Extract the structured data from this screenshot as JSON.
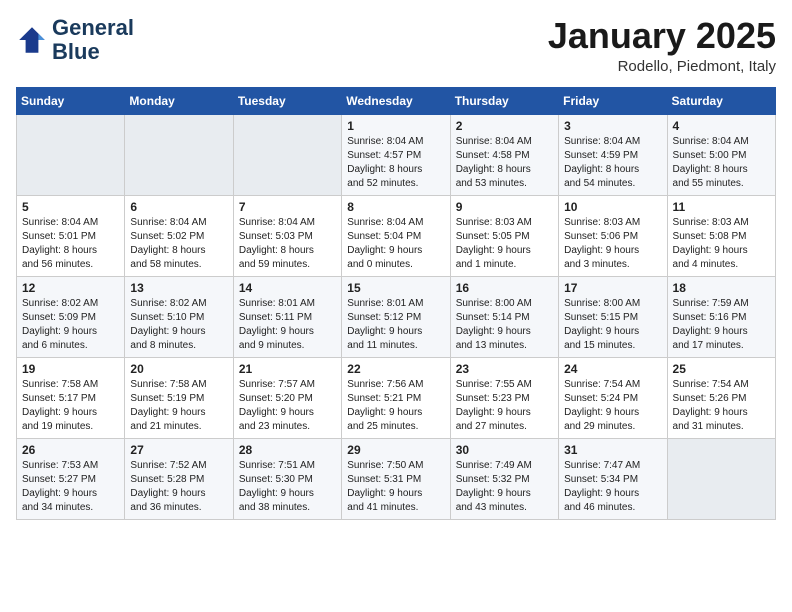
{
  "logo": {
    "line1": "General",
    "line2": "Blue"
  },
  "title": "January 2025",
  "subtitle": "Rodello, Piedmont, Italy",
  "weekdays": [
    "Sunday",
    "Monday",
    "Tuesday",
    "Wednesday",
    "Thursday",
    "Friday",
    "Saturday"
  ],
  "weeks": [
    [
      {
        "day": "",
        "info": ""
      },
      {
        "day": "",
        "info": ""
      },
      {
        "day": "",
        "info": ""
      },
      {
        "day": "1",
        "info": "Sunrise: 8:04 AM\nSunset: 4:57 PM\nDaylight: 8 hours\nand 52 minutes."
      },
      {
        "day": "2",
        "info": "Sunrise: 8:04 AM\nSunset: 4:58 PM\nDaylight: 8 hours\nand 53 minutes."
      },
      {
        "day": "3",
        "info": "Sunrise: 8:04 AM\nSunset: 4:59 PM\nDaylight: 8 hours\nand 54 minutes."
      },
      {
        "day": "4",
        "info": "Sunrise: 8:04 AM\nSunset: 5:00 PM\nDaylight: 8 hours\nand 55 minutes."
      }
    ],
    [
      {
        "day": "5",
        "info": "Sunrise: 8:04 AM\nSunset: 5:01 PM\nDaylight: 8 hours\nand 56 minutes."
      },
      {
        "day": "6",
        "info": "Sunrise: 8:04 AM\nSunset: 5:02 PM\nDaylight: 8 hours\nand 58 minutes."
      },
      {
        "day": "7",
        "info": "Sunrise: 8:04 AM\nSunset: 5:03 PM\nDaylight: 8 hours\nand 59 minutes."
      },
      {
        "day": "8",
        "info": "Sunrise: 8:04 AM\nSunset: 5:04 PM\nDaylight: 9 hours\nand 0 minutes."
      },
      {
        "day": "9",
        "info": "Sunrise: 8:03 AM\nSunset: 5:05 PM\nDaylight: 9 hours\nand 1 minute."
      },
      {
        "day": "10",
        "info": "Sunrise: 8:03 AM\nSunset: 5:06 PM\nDaylight: 9 hours\nand 3 minutes."
      },
      {
        "day": "11",
        "info": "Sunrise: 8:03 AM\nSunset: 5:08 PM\nDaylight: 9 hours\nand 4 minutes."
      }
    ],
    [
      {
        "day": "12",
        "info": "Sunrise: 8:02 AM\nSunset: 5:09 PM\nDaylight: 9 hours\nand 6 minutes."
      },
      {
        "day": "13",
        "info": "Sunrise: 8:02 AM\nSunset: 5:10 PM\nDaylight: 9 hours\nand 8 minutes."
      },
      {
        "day": "14",
        "info": "Sunrise: 8:01 AM\nSunset: 5:11 PM\nDaylight: 9 hours\nand 9 minutes."
      },
      {
        "day": "15",
        "info": "Sunrise: 8:01 AM\nSunset: 5:12 PM\nDaylight: 9 hours\nand 11 minutes."
      },
      {
        "day": "16",
        "info": "Sunrise: 8:00 AM\nSunset: 5:14 PM\nDaylight: 9 hours\nand 13 minutes."
      },
      {
        "day": "17",
        "info": "Sunrise: 8:00 AM\nSunset: 5:15 PM\nDaylight: 9 hours\nand 15 minutes."
      },
      {
        "day": "18",
        "info": "Sunrise: 7:59 AM\nSunset: 5:16 PM\nDaylight: 9 hours\nand 17 minutes."
      }
    ],
    [
      {
        "day": "19",
        "info": "Sunrise: 7:58 AM\nSunset: 5:17 PM\nDaylight: 9 hours\nand 19 minutes."
      },
      {
        "day": "20",
        "info": "Sunrise: 7:58 AM\nSunset: 5:19 PM\nDaylight: 9 hours\nand 21 minutes."
      },
      {
        "day": "21",
        "info": "Sunrise: 7:57 AM\nSunset: 5:20 PM\nDaylight: 9 hours\nand 23 minutes."
      },
      {
        "day": "22",
        "info": "Sunrise: 7:56 AM\nSunset: 5:21 PM\nDaylight: 9 hours\nand 25 minutes."
      },
      {
        "day": "23",
        "info": "Sunrise: 7:55 AM\nSunset: 5:23 PM\nDaylight: 9 hours\nand 27 minutes."
      },
      {
        "day": "24",
        "info": "Sunrise: 7:54 AM\nSunset: 5:24 PM\nDaylight: 9 hours\nand 29 minutes."
      },
      {
        "day": "25",
        "info": "Sunrise: 7:54 AM\nSunset: 5:26 PM\nDaylight: 9 hours\nand 31 minutes."
      }
    ],
    [
      {
        "day": "26",
        "info": "Sunrise: 7:53 AM\nSunset: 5:27 PM\nDaylight: 9 hours\nand 34 minutes."
      },
      {
        "day": "27",
        "info": "Sunrise: 7:52 AM\nSunset: 5:28 PM\nDaylight: 9 hours\nand 36 minutes."
      },
      {
        "day": "28",
        "info": "Sunrise: 7:51 AM\nSunset: 5:30 PM\nDaylight: 9 hours\nand 38 minutes."
      },
      {
        "day": "29",
        "info": "Sunrise: 7:50 AM\nSunset: 5:31 PM\nDaylight: 9 hours\nand 41 minutes."
      },
      {
        "day": "30",
        "info": "Sunrise: 7:49 AM\nSunset: 5:32 PM\nDaylight: 9 hours\nand 43 minutes."
      },
      {
        "day": "31",
        "info": "Sunrise: 7:47 AM\nSunset: 5:34 PM\nDaylight: 9 hours\nand 46 minutes."
      },
      {
        "day": "",
        "info": ""
      }
    ]
  ]
}
